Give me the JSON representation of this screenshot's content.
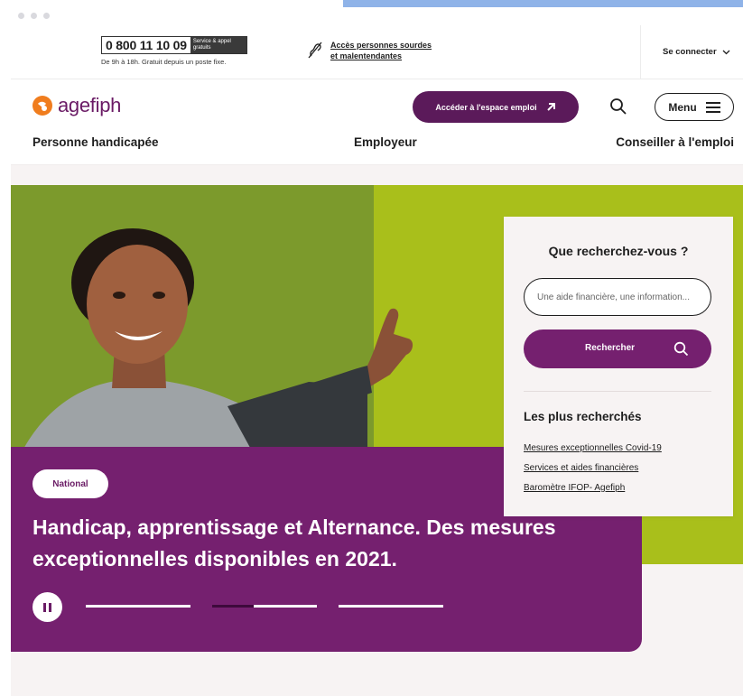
{
  "topbar": {
    "phone_number": "0 800 11 10 09",
    "phone_tag": "Service & appel gratuits",
    "phone_hours": "De 9h à 18h. Gratuit depuis un poste fixe.",
    "deaf_access_line1": "Accès personnes sourdes",
    "deaf_access_line2": "et malentendantes",
    "connect_label": "Se connecter"
  },
  "header": {
    "logo_text": "agefiph",
    "cta_label": "Accéder à l'espace emploi",
    "menu_label": "Menu"
  },
  "nav": {
    "items": [
      {
        "label": "Personne handicapée"
      },
      {
        "label": "Employeur"
      },
      {
        "label": "Conseiller à l'emploi"
      }
    ]
  },
  "hero": {
    "badge": "National",
    "title": "Handicap, apprentissage et Alternance. Des mesures exceptionnelles disponibles en 2021.",
    "slides_total": 3,
    "active_slide": 2,
    "active_slide_progress": 0.4
  },
  "search_panel": {
    "title": "Que recherchez-vous ?",
    "input_placeholder": "Une aide financière, une information...",
    "button_label": "Rechercher",
    "popular_title": "Les plus recherchés",
    "popular_links": [
      {
        "label": "Mesures exceptionnelles Covid-19"
      },
      {
        "label": "Services et aides financières"
      },
      {
        "label": "Baromètre IFOP- Agefiph"
      }
    ]
  },
  "colors": {
    "brand_purple": "#75206f",
    "dark_purple": "#5b1a5a",
    "logo_orange": "#f07d1e",
    "photo_green": "#7c9a2c",
    "photo_lime": "#a9bf1b"
  }
}
